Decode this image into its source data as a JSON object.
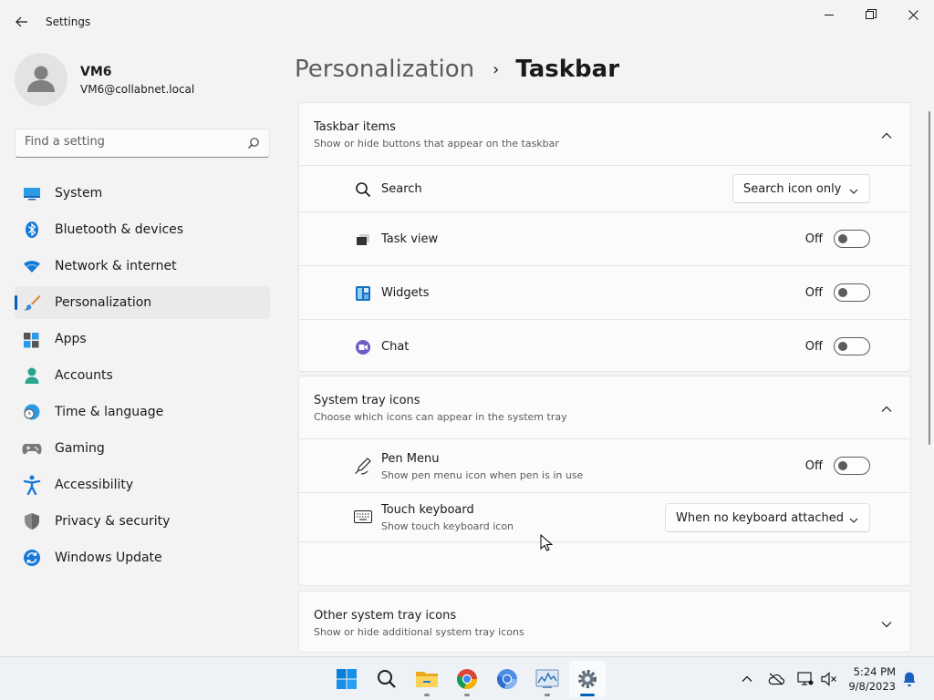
{
  "window": {
    "title": "Settings",
    "controls": [
      "minimize",
      "restore",
      "close"
    ]
  },
  "user": {
    "name": "VM6",
    "email": "VM6@collabnet.local"
  },
  "search": {
    "placeholder": "Find a setting"
  },
  "nav": {
    "items": [
      {
        "label": "System",
        "icon": "system-icon",
        "selected": false
      },
      {
        "label": "Bluetooth & devices",
        "icon": "bluetooth-icon",
        "selected": false
      },
      {
        "label": "Network & internet",
        "icon": "wifi-icon",
        "selected": false
      },
      {
        "label": "Personalization",
        "icon": "paintbrush-icon",
        "selected": true
      },
      {
        "label": "Apps",
        "icon": "apps-icon",
        "selected": false
      },
      {
        "label": "Accounts",
        "icon": "accounts-icon",
        "selected": false
      },
      {
        "label": "Time & language",
        "icon": "clock-globe-icon",
        "selected": false
      },
      {
        "label": "Gaming",
        "icon": "gamepad-icon",
        "selected": false
      },
      {
        "label": "Accessibility",
        "icon": "accessibility-icon",
        "selected": false
      },
      {
        "label": "Privacy & security",
        "icon": "shield-icon",
        "selected": false
      },
      {
        "label": "Windows Update",
        "icon": "update-icon",
        "selected": false
      }
    ]
  },
  "breadcrumb": {
    "parent": "Personalization",
    "separator": "›",
    "current": "Taskbar"
  },
  "taskbar_items": {
    "title": "Taskbar items",
    "subtitle": "Show or hide buttons that appear on the taskbar",
    "search": {
      "label": "Search",
      "value": "Search icon only"
    },
    "task_view": {
      "label": "Task view",
      "state": "Off"
    },
    "widgets": {
      "label": "Widgets",
      "state": "Off"
    },
    "chat": {
      "label": "Chat",
      "state": "Off"
    }
  },
  "system_tray": {
    "title": "System tray icons",
    "subtitle": "Choose which icons can appear in the system tray",
    "pen_menu": {
      "label": "Pen Menu",
      "sub": "Show pen menu icon when pen is in use",
      "state": "Off"
    },
    "touch_keyboard": {
      "label": "Touch keyboard",
      "sub": "Show touch keyboard icon",
      "value": "When no keyboard attached"
    }
  },
  "other_tray": {
    "title": "Other system tray icons",
    "subtitle": "Show or hide additional system tray icons"
  },
  "os_taskbar": {
    "apps": [
      "start-icon",
      "search-icon",
      "file-explorer-icon",
      "chrome-icon",
      "chromium-icon",
      "resource-monitor-icon",
      "settings-gear-icon"
    ],
    "time": "5:24 PM",
    "date": "9/8/2023"
  },
  "colors": {
    "accent": "#005fb8",
    "background": "#f3f3f3",
    "card": "#fbfbfb"
  }
}
